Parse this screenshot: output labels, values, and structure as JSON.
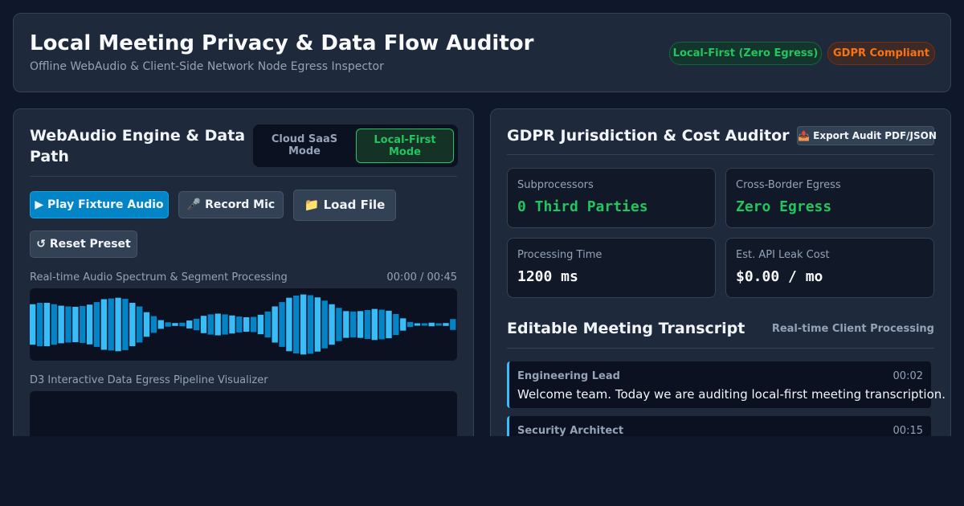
{
  "header": {
    "title": "Local Meeting Privacy & Data Flow Auditor",
    "subtitle": "Offline WebAudio & Client-Side Network Node Egress Inspector",
    "badges": [
      {
        "label": "Local-First (Zero Egress)",
        "color": "#22c55e"
      },
      {
        "label": "GDPR Compliant",
        "color": "#f97316"
      }
    ]
  },
  "audio_panel": {
    "title": "WebAudio Engine & Data Path",
    "modes": [
      {
        "label": "Cloud SaaS Mode",
        "selected": false
      },
      {
        "label": "Local-First Mode",
        "selected": true
      }
    ],
    "buttons": {
      "play": {
        "icon": "play-icon",
        "glyph": "▶",
        "label": "Play Fixture Audio"
      },
      "record": {
        "icon": "microphone-icon",
        "glyph": "🎤",
        "label": "Record Mic"
      },
      "load": {
        "icon": "folder-icon",
        "glyph": "📁",
        "label": "Load File"
      },
      "reset": {
        "icon": "reset-icon",
        "glyph": "↺",
        "label": "Reset Preset"
      }
    },
    "spectrum_label": "Real-time Audio Spectrum & Segment Processing",
    "time_readout": "00:00 / 00:45",
    "spectrum_levels": [
      0.56,
      0.6,
      0.6,
      0.56,
      0.52,
      0.5,
      0.49,
      0.51,
      0.55,
      0.62,
      0.7,
      0.72,
      0.74,
      0.71,
      0.6,
      0.5,
      0.34,
      0.23,
      0.12,
      0.06,
      0.04,
      0.05,
      0.11,
      0.16,
      0.24,
      0.28,
      0.3,
      0.28,
      0.25,
      0.22,
      0.2,
      0.21,
      0.27,
      0.36,
      0.5,
      0.62,
      0.74,
      0.8,
      0.83,
      0.81,
      0.75,
      0.66,
      0.56,
      0.46,
      0.37,
      0.36,
      0.37,
      0.4,
      0.43,
      0.41,
      0.38,
      0.29,
      0.17,
      0.07,
      0.02,
      0.01,
      0.05,
      0.03,
      0.04,
      0.15
    ],
    "egress_label": "D3 Interactive Data Egress Pipeline Visualizer"
  },
  "auditor_panel": {
    "title": "GDPR Jurisdiction & Cost Auditor",
    "export": {
      "icon": "export-icon",
      "glyph": "📤",
      "label": "Export Audit PDF/JSON"
    },
    "stats": [
      {
        "label": "Subprocessors",
        "value": "0 Third Parties",
        "accent": "green"
      },
      {
        "label": "Cross-Border Egress",
        "value": "Zero Egress",
        "accent": "green"
      },
      {
        "label": "Processing Time",
        "value": "1200 ms",
        "accent": "white"
      },
      {
        "label": "Est. API Leak Cost",
        "value": "$0.00 / mo",
        "accent": "white"
      }
    ]
  },
  "transcript": {
    "title": "Editable Meeting Transcript",
    "subtitle": "Real-time Client Processing",
    "entries": [
      {
        "speaker": "Engineering Lead",
        "time": "00:02",
        "text": "Welcome team. Today we are auditing local-first meeting transcription."
      },
      {
        "speaker": "Security Architect",
        "time": "00:15",
        "text": ""
      }
    ]
  },
  "colors": {
    "accent": "#0ea5e9",
    "success": "#22c55e",
    "warning": "#f97316",
    "background": "#0f172a",
    "panel": "#1e293b"
  }
}
